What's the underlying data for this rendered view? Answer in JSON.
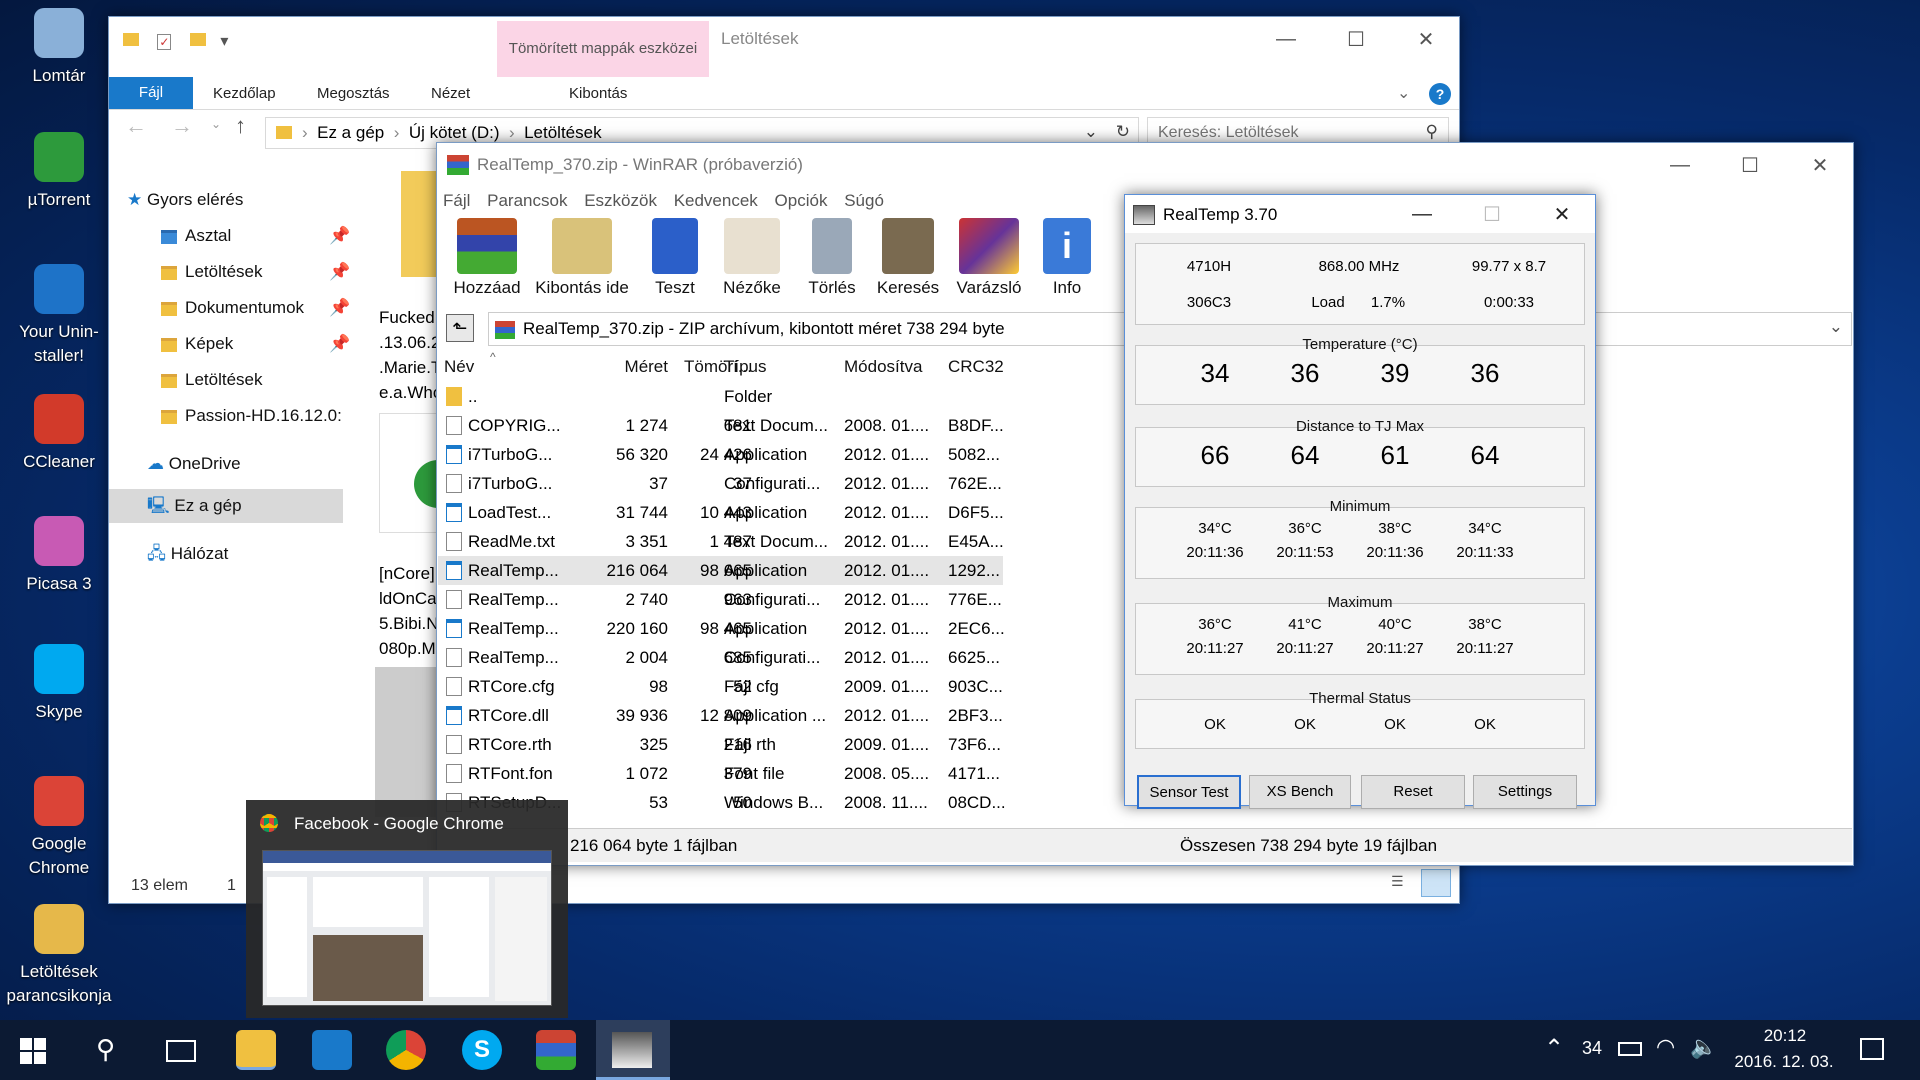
{
  "desktop": {
    "icons": [
      {
        "label": "Lomtár",
        "icon": "recycle-bin-icon",
        "color": "#8ab0d8"
      },
      {
        "label": "µTorrent",
        "icon": "utorrent-icon",
        "color": "#2d9a3c"
      },
      {
        "label": "Your Unin-staller!",
        "icon": "uninstaller-icon",
        "color": "#1e73c8"
      },
      {
        "label": "CCleaner",
        "icon": "ccleaner-icon",
        "color": "#d23a2a"
      },
      {
        "label": "Picasa 3",
        "icon": "picasa-icon",
        "color": "#c85ab4"
      },
      {
        "label": "Skype",
        "icon": "skype-icon",
        "color": "#00a9f0"
      },
      {
        "label": "Google Chrome",
        "icon": "chrome-icon",
        "color": "#db4437"
      },
      {
        "label": "Letöltések parancsikonja",
        "icon": "downloads-shortcut-icon",
        "color": "#e6b84a"
      }
    ]
  },
  "explorer": {
    "context_tab": "Tömörített mappák eszközei",
    "title": "Letöltések",
    "tabs": [
      "Fájl",
      "Kezdőlap",
      "Megosztás",
      "Nézet"
    ],
    "context_subtab": "Kibontás",
    "breadcrumb": [
      "Ez a gép",
      "Új kötet (D:)",
      "Letöltések"
    ],
    "search_placeholder": "Keresés: Letöltések",
    "nav": [
      "Gyors elérés",
      "Asztal",
      "Letöltések",
      "Dokumentumok",
      "Képek",
      "Letöltések",
      "Passion-HD.16.12.0:",
      "OneDrive",
      "Ez a gép",
      "Hálózat"
    ],
    "content_text_1": "Fucked\n.13.06.2\n.Marie.T\ne.a.Who",
    "content_text_2": "[nCore]\nldOnCa\n5.Bibi.N\n080p.M",
    "status": "13 elem",
    "status2": "1 "
  },
  "winrar": {
    "title": "RealTemp_370.zip - WinRAR (próbaverzió)",
    "menu": [
      "Fájl",
      "Parancsok",
      "Eszközök",
      "Kedvencek",
      "Opciók",
      "Súgó"
    ],
    "toolbar": [
      "Hozzáad",
      "Kibontás ide",
      "Teszt",
      "Nézőke",
      "Törlés",
      "Keresés",
      "Varázsló",
      "Info"
    ],
    "path": "RealTemp_370.zip - ZIP archívum, kibontott méret 738 294 byte",
    "columns": [
      "Név",
      "Méret",
      "Tömörí...",
      "Típus",
      "Módosítva",
      "CRC32"
    ],
    "rows": [
      [
        "..",
        "",
        "",
        "Folder",
        "",
        ""
      ],
      [
        "COPYRIG...",
        "1 274",
        "681",
        "Text Docum...",
        "2008. 01....",
        "B8DF..."
      ],
      [
        "i7TurboG...",
        "56 320",
        "24 426",
        "Application",
        "2012. 01....",
        "5082..."
      ],
      [
        "i7TurboG...",
        "37",
        "37",
        "Configurati...",
        "2012. 01....",
        "762E..."
      ],
      [
        "LoadTest...",
        "31 744",
        "10 443",
        "Application",
        "2012. 01....",
        "D6F5..."
      ],
      [
        "ReadMe.txt",
        "3 351",
        "1 487",
        "Text Docum...",
        "2012. 01....",
        "E45A..."
      ],
      [
        "RealTemp...",
        "216 064",
        "98 665",
        "Application",
        "2012. 01....",
        "1292..."
      ],
      [
        "RealTemp...",
        "2 740",
        "963",
        "Configurati...",
        "2012. 01....",
        "776E..."
      ],
      [
        "RealTemp...",
        "220 160",
        "98 465",
        "Application",
        "2012. 01....",
        "2EC6..."
      ],
      [
        "RealTemp...",
        "2 004",
        "685",
        "Configurati...",
        "2012. 01....",
        "6625..."
      ],
      [
        "RTCore.cfg",
        "98",
        "52",
        "Fájl cfg",
        "2009. 01....",
        "903C..."
      ],
      [
        "RTCore.dll",
        "39 936",
        "12 809",
        "Application ...",
        "2012. 01....",
        "2BF3..."
      ],
      [
        "RTCore.rth",
        "325",
        "216",
        "Fájl rth",
        "2009. 01....",
        "73F6..."
      ],
      [
        "RTFont.fon",
        "1 072",
        "379",
        "Font file",
        "2008. 05....",
        "4171..."
      ],
      [
        "RTSetupD...",
        "53",
        "50",
        "Windows B...",
        "2008. 11....",
        "08CD..."
      ]
    ],
    "status_left": "216 064 byte 1 fájlban",
    "status_right": "Összesen 738 294 byte 19 fájlban"
  },
  "realtemp": {
    "title": "RealTemp 3.70",
    "info": [
      "4710H",
      "868.00 MHz",
      "99.77 x 8.7",
      "306C3",
      "Load",
      "1.7%",
      "0:00:33"
    ],
    "temperature_label": "Temperature (°C)",
    "temperature": [
      "34",
      "36",
      "39",
      "36"
    ],
    "tjmax_label": "Distance to TJ Max",
    "tjmax": [
      "66",
      "64",
      "61",
      "64"
    ],
    "min_label": "Minimum",
    "min_temp": [
      "34°C",
      "36°C",
      "38°C",
      "34°C"
    ],
    "min_time": [
      "20:11:36",
      "20:11:53",
      "20:11:36",
      "20:11:33"
    ],
    "max_label": "Maximum",
    "max_temp": [
      "36°C",
      "41°C",
      "40°C",
      "38°C"
    ],
    "max_time": [
      "20:11:27",
      "20:11:27",
      "20:11:27",
      "20:11:27"
    ],
    "thermal_label": "Thermal Status",
    "thermal": [
      "OK",
      "OK",
      "OK",
      "OK"
    ],
    "buttons": [
      "Sensor Test",
      "XS Bench",
      "Reset",
      "Settings"
    ]
  },
  "chrome_preview": {
    "title": "Facebook - Google Chrome"
  },
  "taskbar": {
    "temp": "34",
    "time": "20:12",
    "date": "2016. 12. 03.",
    "accent": "#0c1a33"
  }
}
